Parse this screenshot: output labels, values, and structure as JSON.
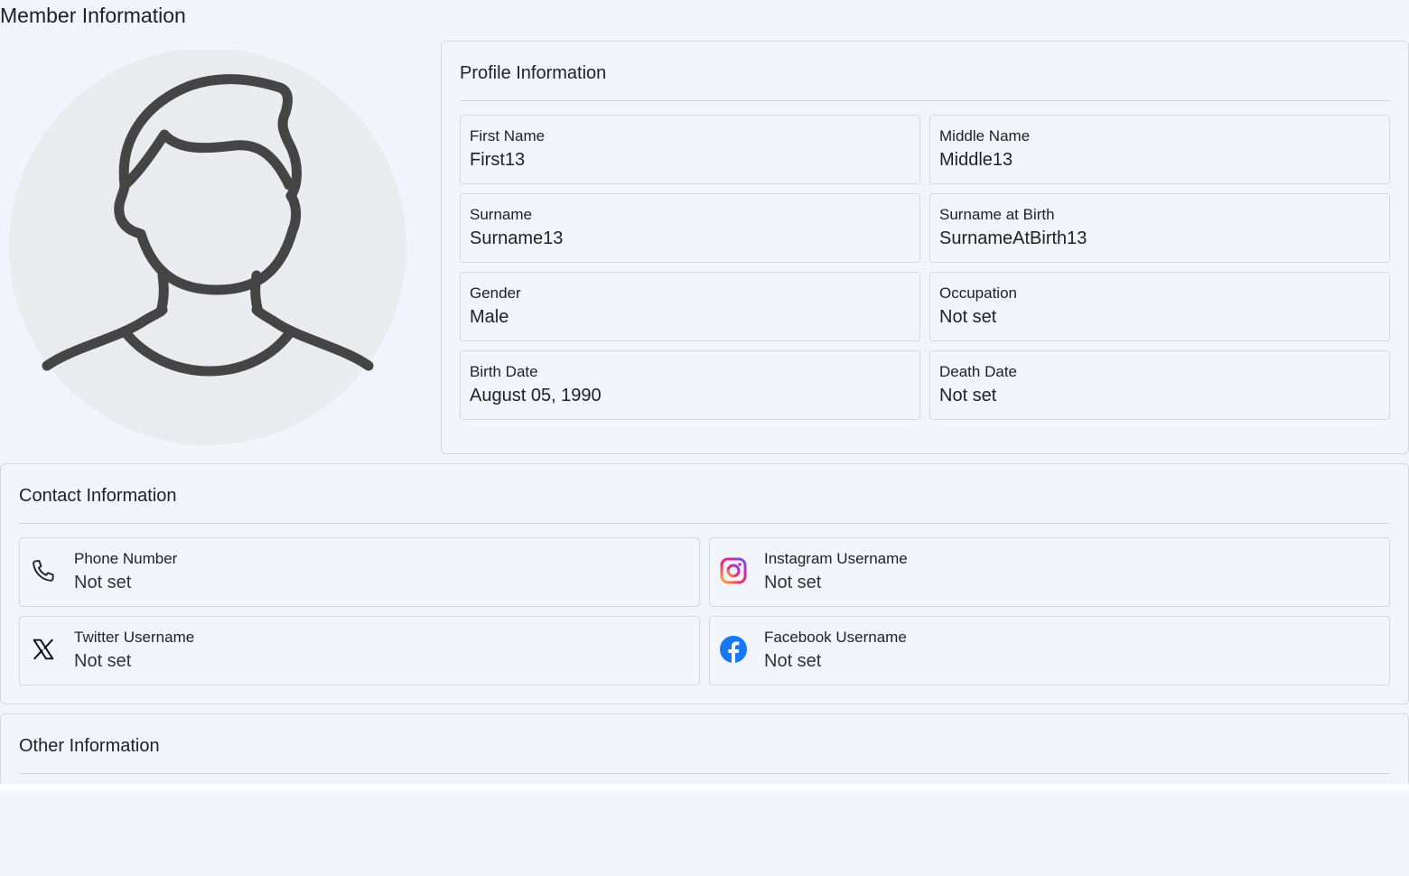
{
  "page": {
    "title": "Member Information"
  },
  "avatar": {
    "icon": "person-silhouette-icon",
    "bg_color": "#e8eaee",
    "stroke_color": "#454545"
  },
  "profile": {
    "title": "Profile Information",
    "fields": [
      {
        "label": "First Name",
        "value": "First13"
      },
      {
        "label": "Middle Name",
        "value": "Middle13"
      },
      {
        "label": "Surname",
        "value": "Surname13"
      },
      {
        "label": "Surname at Birth",
        "value": "SurnameAtBirth13"
      },
      {
        "label": "Gender",
        "value": "Male"
      },
      {
        "label": "Occupation",
        "value": "Not set"
      },
      {
        "label": "Birth Date",
        "value": "August 05, 1990"
      },
      {
        "label": "Death Date",
        "value": "Not set"
      }
    ]
  },
  "contact": {
    "title": "Contact Information",
    "fields": [
      {
        "label": "Phone Number",
        "value": "Not set",
        "icon": "phone-icon"
      },
      {
        "label": "Instagram Username",
        "value": "Not set",
        "icon": "instagram-icon"
      },
      {
        "label": "Twitter Username",
        "value": "Not set",
        "icon": "x-twitter-icon"
      },
      {
        "label": "Facebook Username",
        "value": "Not set",
        "icon": "facebook-icon"
      }
    ]
  },
  "other": {
    "title": "Other Information"
  },
  "colors": {
    "background": "#f1f4fb",
    "border": "#d5d8de",
    "facebook": "#1877f2"
  }
}
